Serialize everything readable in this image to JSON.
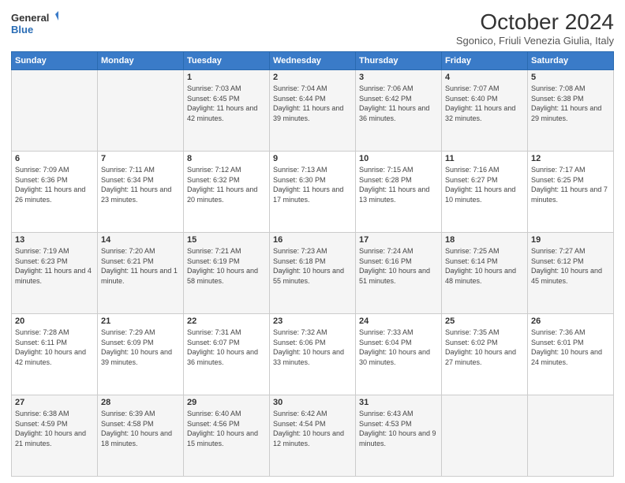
{
  "header": {
    "logo_line1": "General",
    "logo_line2": "Blue",
    "month": "October 2024",
    "location": "Sgonico, Friuli Venezia Giulia, Italy"
  },
  "days_of_week": [
    "Sunday",
    "Monday",
    "Tuesday",
    "Wednesday",
    "Thursday",
    "Friday",
    "Saturday"
  ],
  "weeks": [
    [
      {
        "day": "",
        "info": ""
      },
      {
        "day": "",
        "info": ""
      },
      {
        "day": "1",
        "info": "Sunrise: 7:03 AM\nSunset: 6:45 PM\nDaylight: 11 hours and 42 minutes."
      },
      {
        "day": "2",
        "info": "Sunrise: 7:04 AM\nSunset: 6:44 PM\nDaylight: 11 hours and 39 minutes."
      },
      {
        "day": "3",
        "info": "Sunrise: 7:06 AM\nSunset: 6:42 PM\nDaylight: 11 hours and 36 minutes."
      },
      {
        "day": "4",
        "info": "Sunrise: 7:07 AM\nSunset: 6:40 PM\nDaylight: 11 hours and 32 minutes."
      },
      {
        "day": "5",
        "info": "Sunrise: 7:08 AM\nSunset: 6:38 PM\nDaylight: 11 hours and 29 minutes."
      }
    ],
    [
      {
        "day": "6",
        "info": "Sunrise: 7:09 AM\nSunset: 6:36 PM\nDaylight: 11 hours and 26 minutes."
      },
      {
        "day": "7",
        "info": "Sunrise: 7:11 AM\nSunset: 6:34 PM\nDaylight: 11 hours and 23 minutes."
      },
      {
        "day": "8",
        "info": "Sunrise: 7:12 AM\nSunset: 6:32 PM\nDaylight: 11 hours and 20 minutes."
      },
      {
        "day": "9",
        "info": "Sunrise: 7:13 AM\nSunset: 6:30 PM\nDaylight: 11 hours and 17 minutes."
      },
      {
        "day": "10",
        "info": "Sunrise: 7:15 AM\nSunset: 6:28 PM\nDaylight: 11 hours and 13 minutes."
      },
      {
        "day": "11",
        "info": "Sunrise: 7:16 AM\nSunset: 6:27 PM\nDaylight: 11 hours and 10 minutes."
      },
      {
        "day": "12",
        "info": "Sunrise: 7:17 AM\nSunset: 6:25 PM\nDaylight: 11 hours and 7 minutes."
      }
    ],
    [
      {
        "day": "13",
        "info": "Sunrise: 7:19 AM\nSunset: 6:23 PM\nDaylight: 11 hours and 4 minutes."
      },
      {
        "day": "14",
        "info": "Sunrise: 7:20 AM\nSunset: 6:21 PM\nDaylight: 11 hours and 1 minute."
      },
      {
        "day": "15",
        "info": "Sunrise: 7:21 AM\nSunset: 6:19 PM\nDaylight: 10 hours and 58 minutes."
      },
      {
        "day": "16",
        "info": "Sunrise: 7:23 AM\nSunset: 6:18 PM\nDaylight: 10 hours and 55 minutes."
      },
      {
        "day": "17",
        "info": "Sunrise: 7:24 AM\nSunset: 6:16 PM\nDaylight: 10 hours and 51 minutes."
      },
      {
        "day": "18",
        "info": "Sunrise: 7:25 AM\nSunset: 6:14 PM\nDaylight: 10 hours and 48 minutes."
      },
      {
        "day": "19",
        "info": "Sunrise: 7:27 AM\nSunset: 6:12 PM\nDaylight: 10 hours and 45 minutes."
      }
    ],
    [
      {
        "day": "20",
        "info": "Sunrise: 7:28 AM\nSunset: 6:11 PM\nDaylight: 10 hours and 42 minutes."
      },
      {
        "day": "21",
        "info": "Sunrise: 7:29 AM\nSunset: 6:09 PM\nDaylight: 10 hours and 39 minutes."
      },
      {
        "day": "22",
        "info": "Sunrise: 7:31 AM\nSunset: 6:07 PM\nDaylight: 10 hours and 36 minutes."
      },
      {
        "day": "23",
        "info": "Sunrise: 7:32 AM\nSunset: 6:06 PM\nDaylight: 10 hours and 33 minutes."
      },
      {
        "day": "24",
        "info": "Sunrise: 7:33 AM\nSunset: 6:04 PM\nDaylight: 10 hours and 30 minutes."
      },
      {
        "day": "25",
        "info": "Sunrise: 7:35 AM\nSunset: 6:02 PM\nDaylight: 10 hours and 27 minutes."
      },
      {
        "day": "26",
        "info": "Sunrise: 7:36 AM\nSunset: 6:01 PM\nDaylight: 10 hours and 24 minutes."
      }
    ],
    [
      {
        "day": "27",
        "info": "Sunrise: 6:38 AM\nSunset: 4:59 PM\nDaylight: 10 hours and 21 minutes."
      },
      {
        "day": "28",
        "info": "Sunrise: 6:39 AM\nSunset: 4:58 PM\nDaylight: 10 hours and 18 minutes."
      },
      {
        "day": "29",
        "info": "Sunrise: 6:40 AM\nSunset: 4:56 PM\nDaylight: 10 hours and 15 minutes."
      },
      {
        "day": "30",
        "info": "Sunrise: 6:42 AM\nSunset: 4:54 PM\nDaylight: 10 hours and 12 minutes."
      },
      {
        "day": "31",
        "info": "Sunrise: 6:43 AM\nSunset: 4:53 PM\nDaylight: 10 hours and 9 minutes."
      },
      {
        "day": "",
        "info": ""
      },
      {
        "day": "",
        "info": ""
      }
    ]
  ]
}
